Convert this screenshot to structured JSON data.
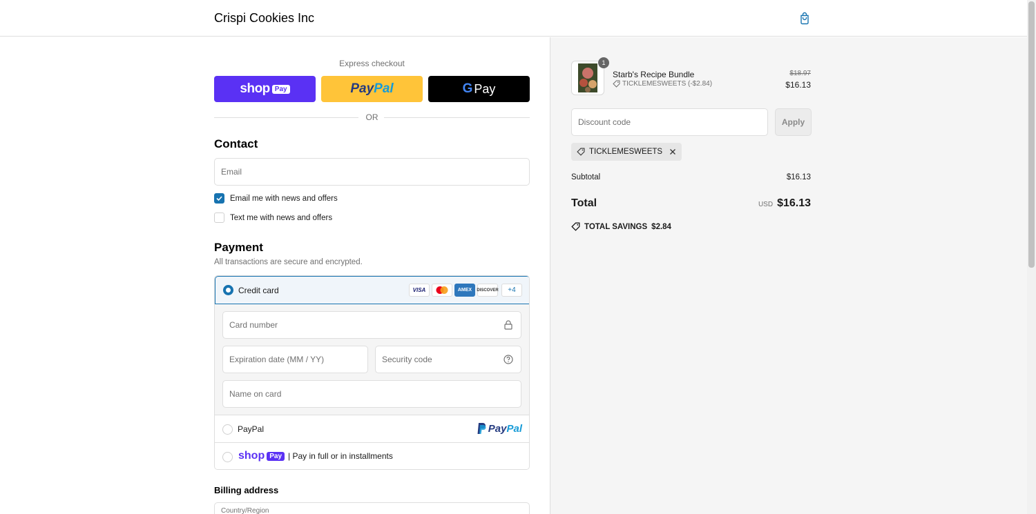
{
  "header": {
    "brand": "Crispi Cookies Inc",
    "cart_icon": "shopping-bag-icon"
  },
  "express": {
    "label": "Express checkout",
    "shop_pay": {
      "word": "shop",
      "badge": "Pay"
    },
    "paypal": {
      "pay": "Pay",
      "pal": "Pal"
    },
    "gpay": {
      "g": "G",
      "pay": "Pay"
    },
    "or": "OR"
  },
  "contact": {
    "title": "Contact",
    "email_placeholder": "Email",
    "email_news": {
      "label": "Email me with news and offers",
      "checked": true
    },
    "text_news": {
      "label": "Text me with news and offers",
      "checked": false
    }
  },
  "payment": {
    "title": "Payment",
    "subtitle": "All transactions are secure and encrypted.",
    "credit_card": {
      "label": "Credit card",
      "brands": [
        "VISA",
        "MC",
        "AMEX",
        "DISCOVER"
      ],
      "more": "+4",
      "selected": true
    },
    "card_number_placeholder": "Card number",
    "expiration_placeholder": "Expiration date (MM / YY)",
    "security_placeholder": "Security code",
    "name_placeholder": "Name on card",
    "paypal": {
      "label": "PayPal",
      "logo_pay": "Pay",
      "logo_pal": "Pal"
    },
    "shop_pay": {
      "word": "shop",
      "badge": "Pay",
      "label": "| Pay in full or in installments"
    }
  },
  "billing": {
    "title": "Billing address",
    "country_placeholder": "Country/Region"
  },
  "summary": {
    "product": {
      "name": "Starb's Recipe Bundle",
      "quantity": "1",
      "discount_label": "TICKLEMESWEETS (-$2.84)",
      "original_price": "$18.97",
      "price": "$16.13"
    },
    "discount_placeholder": "Discount code",
    "apply_label": "Apply",
    "applied_code": "TICKLEMESWEETS",
    "subtotal_label": "Subtotal",
    "subtotal_value": "$16.13",
    "total_label": "Total",
    "total_currency": "USD",
    "total_value": "$16.13",
    "savings_label": "TOTAL SAVINGS",
    "savings_value": "$2.84"
  },
  "colors": {
    "accent": "#1773b0",
    "shop_pay": "#5a31f4",
    "paypal": "#ffc439",
    "gpay": "#000000"
  }
}
